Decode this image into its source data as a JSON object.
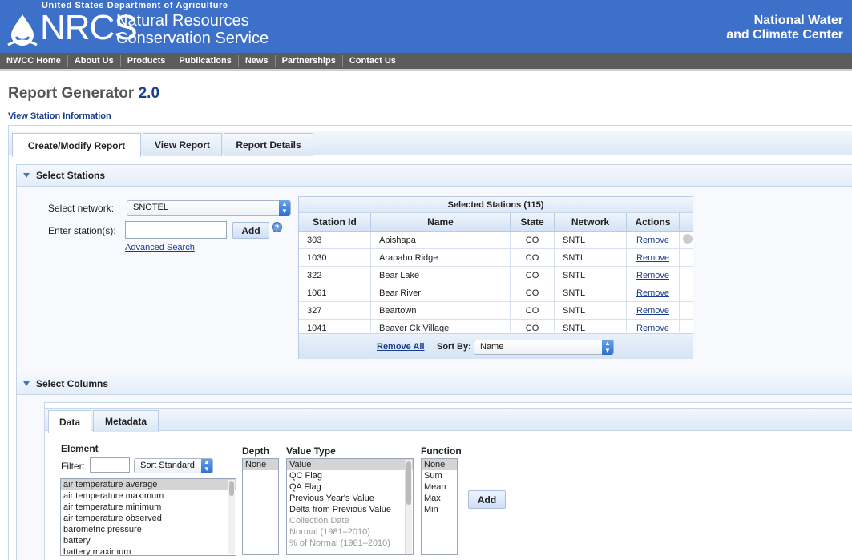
{
  "header": {
    "agency": "United States Department of Agriculture",
    "logo_text": "NRCS",
    "org_line1": "Natural Resources",
    "org_line2": "Conservation Service",
    "center_line1": "National Water",
    "center_line2": "and Climate Center",
    "colors": {
      "header_bg": "#3d70c8",
      "nav_bg": "#5c5c5c",
      "link": "#1a3d8f"
    }
  },
  "nav": [
    "NWCC Home",
    "About Us",
    "Products",
    "Publications",
    "News",
    "Partnerships",
    "Contact Us"
  ],
  "page": {
    "title": "Report Generator",
    "version": "2.0",
    "view_station_link": "View Station Information"
  },
  "tabs": [
    "Create/Modify Report",
    "View Report",
    "Report Details"
  ],
  "select_stations": {
    "heading": "Select Stations",
    "network_label": "Select network:",
    "network_value": "SNOTEL",
    "station_label": "Enter station(s):",
    "add_label": "Add",
    "help_icon": "?",
    "advanced_search": "Advanced Search",
    "table": {
      "caption": "Selected Stations (115)",
      "columns": [
        "Station Id",
        "Name",
        "State",
        "Network",
        "Actions"
      ],
      "rows": [
        [
          "303",
          "Apishapa",
          "CO",
          "SNTL",
          "Remove"
        ],
        [
          "1030",
          "Arapaho Ridge",
          "CO",
          "SNTL",
          "Remove"
        ],
        [
          "322",
          "Bear Lake",
          "CO",
          "SNTL",
          "Remove"
        ],
        [
          "1061",
          "Bear River",
          "CO",
          "SNTL",
          "Remove"
        ],
        [
          "327",
          "Beartown",
          "CO",
          "SNTL",
          "Remove"
        ],
        [
          "1041",
          "Beaver Ck Village",
          "CO",
          "SNTL",
          "Remove"
        ]
      ],
      "remove_all": "Remove All",
      "sort_by_label": "Sort By:",
      "sort_by_value": "Name"
    }
  },
  "select_columns": {
    "heading": "Select Columns",
    "subtabs": [
      "Data",
      "Metadata"
    ],
    "element_heading": "Element",
    "filter_label": "Filter:",
    "sort_value": "Sort Standard",
    "elements": [
      "air temperature average",
      "air temperature maximum",
      "air temperature minimum",
      "air temperature observed",
      "barometric pressure",
      "battery",
      "battery maximum"
    ],
    "depth_heading": "Depth",
    "depth_options": [
      "None"
    ],
    "value_type_heading": "Value Type",
    "value_types": [
      "Value",
      "QC Flag",
      "QA Flag",
      "Previous Year's Value",
      "Delta from Previous Value",
      "Collection Date",
      "Normal (1981–2010)",
      "% of Normal (1981–2010)"
    ],
    "function_heading": "Function",
    "functions": [
      "None",
      "Sum",
      "Mean",
      "Max",
      "Min"
    ],
    "add_label": "Add"
  }
}
